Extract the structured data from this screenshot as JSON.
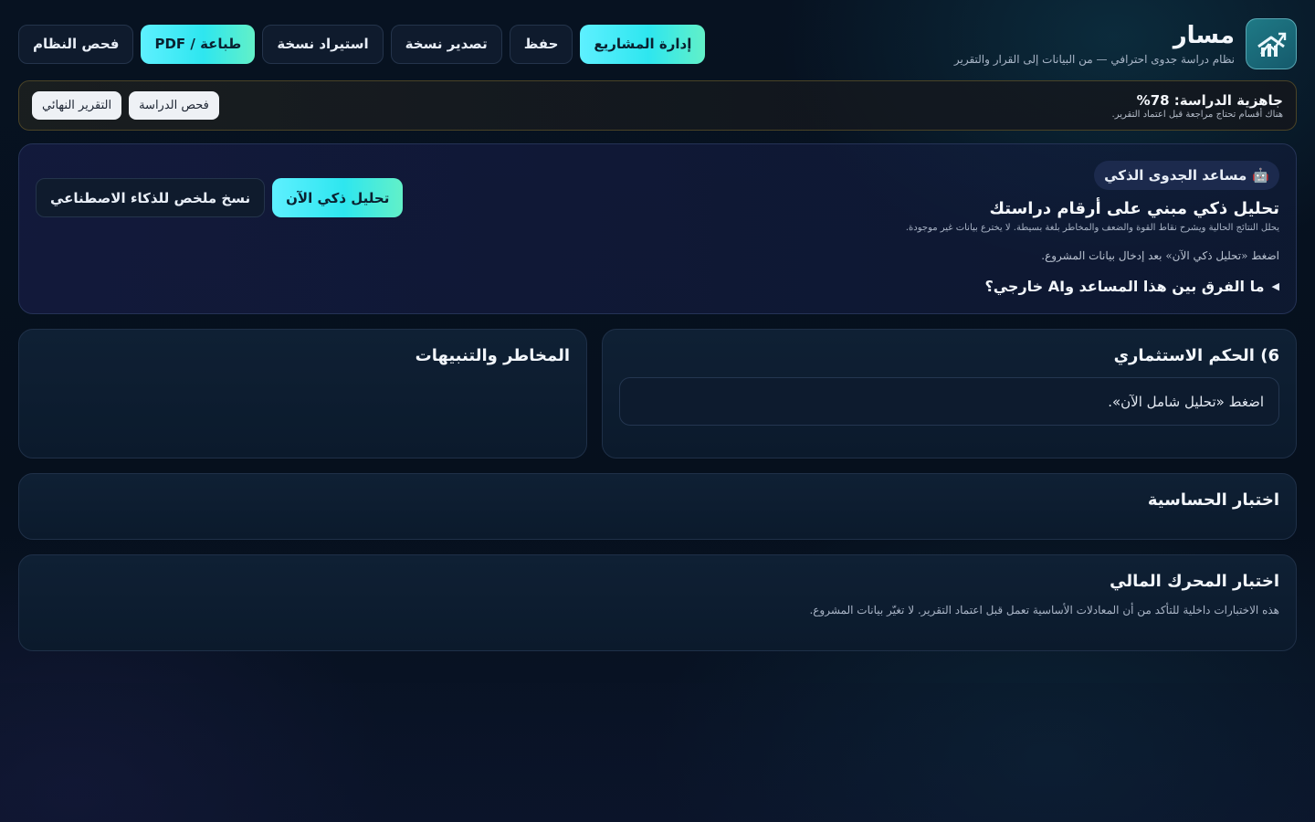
{
  "brand": {
    "title": "مسار",
    "subtitle": "نظام دراسة جدوى احترافي — من البيانات إلى القرار والتقرير",
    "logo_icon": "chart-trend-icon"
  },
  "toolbar": {
    "manage_projects": "إدارة المشاريع",
    "save": "حفظ",
    "export_copy": "تصدير نسخة",
    "import_copy": "استيراد نسخة",
    "print_pdf": "طباعة / PDF",
    "system_check": "فحص النظام"
  },
  "readiness": {
    "title": "جاهزية الدراسة: 78%",
    "subtitle": "هناك أقسام تحتاج مراجعة قبل اعتماد التقرير.",
    "check_study": "فحص الدراسة",
    "final_report": "التقرير النهائي"
  },
  "assistant": {
    "badge_icon": "robot-icon",
    "badge_emoji": "🤖",
    "badge": "مساعد الجدوى الذكي",
    "title": "تحليل ذكي مبني على أرقام دراستك",
    "subtitle": "يحلل النتائج الحالية ويشرح نقاط القوة والضعف والمخاطر بلغة بسيطة. لا يخترع بيانات غير موجودة.",
    "hint": "اضغط «تحليل ذكي الآن» بعد إدخال بيانات المشروع.",
    "details_toggle": "ما الفرق بين هذا المساعد وAI خارجي؟",
    "analyze_now": "تحليل ذكي الآن",
    "copy_ai_summary": "نسخ ملخص للذكاء الاصطناعي"
  },
  "verdict": {
    "title": "6) الحكم الاستثماري",
    "placeholder": "اضغط «تحليل شامل الآن»."
  },
  "risks": {
    "title": "المخاطر والتنبيهات"
  },
  "sensitivity": {
    "title": "اختبار الحساسية"
  },
  "engine": {
    "title": "اختبار المحرك المالي",
    "subtitle": "هذه الاختبارات داخلية للتأكد من أن المعادلات الأساسية تعمل قبل اعتماد التقرير. لا تغيّر بيانات المشروع."
  },
  "colors": {
    "accent_start": "#5ef0ff",
    "accent_end": "#62f0c8",
    "background": "#071221"
  }
}
